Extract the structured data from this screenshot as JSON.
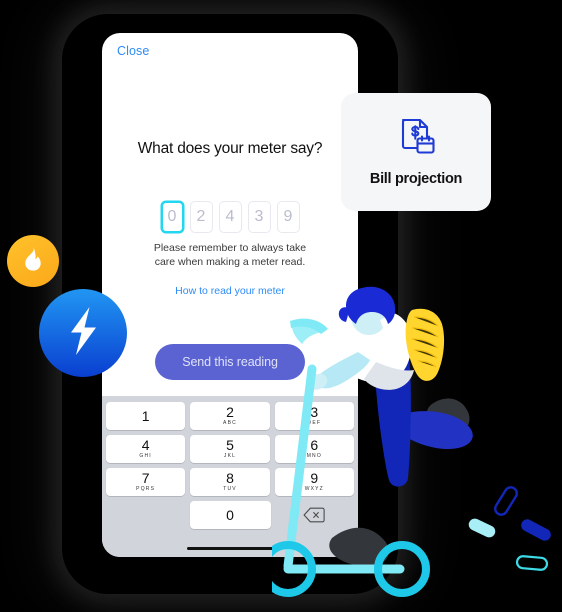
{
  "screen": {
    "close_label": "Close",
    "question": "What does your meter say?",
    "meter_digits": [
      "0",
      "2",
      "4",
      "3",
      "9"
    ],
    "active_digit_index": 0,
    "note_line1": "Please remember to always take",
    "note_line2": "care when making a meter read.",
    "howto_link": "How to read your meter",
    "send_label": "Send this reading",
    "accent_active": "#22d7ef",
    "accent_link": "#2f8cf5",
    "accent_button": "#5b63d3"
  },
  "keypad": {
    "rows": [
      [
        {
          "num": "1",
          "sub": ""
        },
        {
          "num": "2",
          "sub": "ABC"
        },
        {
          "num": "3",
          "sub": "DEF"
        }
      ],
      [
        {
          "num": "4",
          "sub": "GHI"
        },
        {
          "num": "5",
          "sub": "JKL"
        },
        {
          "num": "6",
          "sub": "MNO"
        }
      ],
      [
        {
          "num": "7",
          "sub": "PQRS"
        },
        {
          "num": "8",
          "sub": "TUV"
        },
        {
          "num": "9",
          "sub": "WXYZ"
        }
      ]
    ],
    "zero": {
      "num": "0",
      "sub": ""
    },
    "delete_icon": "backspace-icon"
  },
  "bill_card": {
    "title": "Bill projection",
    "icon": "bill-projection-icon",
    "icon_color": "#1f3bd6",
    "background": "#f5f6f8"
  },
  "badges": [
    {
      "name": "gas-badge",
      "icon": "flame-icon",
      "color": "#ffb81c"
    },
    {
      "name": "electricity-badge",
      "icon": "lightning-bolt-icon",
      "color": "#0a3fd0"
    }
  ],
  "illustration": {
    "name": "person-riding-scooter",
    "scooter_color": "#7fe9f5",
    "wheel_color": "#1ec8e8",
    "trousers_color": "#1227b8",
    "backpack_color": "#ffd52e",
    "hair_color": "#1a2bd6",
    "skin_color": "#cfeff7"
  }
}
